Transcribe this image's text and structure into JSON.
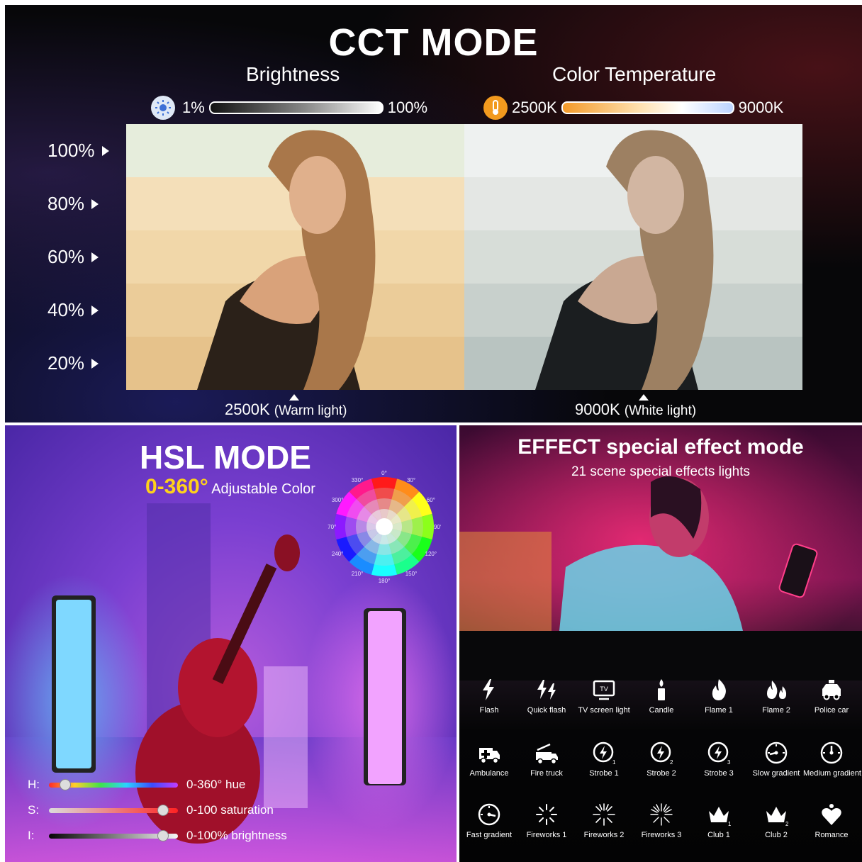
{
  "cct": {
    "title": "CCT MODE",
    "brightness_label": "Brightness",
    "brightness_min": "1%",
    "brightness_max": "100%",
    "color_temp_label": "Color Temperature",
    "temp_min": "2500K",
    "temp_max": "9000K",
    "levels": [
      "100%",
      "80%",
      "60%",
      "40%",
      "20%"
    ],
    "warm_caption": "2500K",
    "warm_caption_note": "(Warm light)",
    "white_caption": "9000K",
    "white_caption_note": "(White light)"
  },
  "hsl": {
    "title": "HSL MODE",
    "range": "0-360°",
    "range_note": "Adjustable Color",
    "wheel_degrees": [
      "0°",
      "30°",
      "60°",
      "90°",
      "120°",
      "150°",
      "180°",
      "210°",
      "240°",
      "270°",
      "300°",
      "330°"
    ],
    "sliders": [
      {
        "key": "H:",
        "label": "0-360° hue",
        "level": 0.12
      },
      {
        "key": "S:",
        "label": "0-100 saturation",
        "level": 0.88
      },
      {
        "key": "I:",
        "label": "0-100% brightness",
        "level": 0.88
      }
    ]
  },
  "effect": {
    "title": "EFFECT special effect mode",
    "subtitle": "21 scene special effects lights",
    "items": [
      {
        "label": "Flash",
        "icon": "lightning-icon"
      },
      {
        "label": "Quick flash",
        "icon": "double-lightning-icon"
      },
      {
        "label": "TV screen light",
        "icon": "tv-icon"
      },
      {
        "label": "Candle",
        "icon": "candle-icon"
      },
      {
        "label": "Flame 1",
        "icon": "flame-icon"
      },
      {
        "label": "Flame 2",
        "icon": "double-flame-icon"
      },
      {
        "label": "Police car",
        "icon": "police-car-icon"
      },
      {
        "label": "Ambulance",
        "icon": "ambulance-icon"
      },
      {
        "label": "Fire truck",
        "icon": "fire-truck-icon"
      },
      {
        "label": "Strobe 1",
        "icon": "strobe-1-icon"
      },
      {
        "label": "Strobe 2",
        "icon": "strobe-2-icon"
      },
      {
        "label": "Strobe 3",
        "icon": "strobe-3-icon"
      },
      {
        "label": "Slow gradient",
        "icon": "gauge-slow-icon"
      },
      {
        "label": "Medium gradient",
        "icon": "gauge-medium-icon"
      },
      {
        "label": "Fast gradient",
        "icon": "gauge-fast-icon"
      },
      {
        "label": "Fireworks 1",
        "icon": "fireworks-1-icon"
      },
      {
        "label": "Fireworks 2",
        "icon": "fireworks-2-icon"
      },
      {
        "label": "Fireworks 3",
        "icon": "fireworks-3-icon"
      },
      {
        "label": "Club 1",
        "icon": "crown-1-icon"
      },
      {
        "label": "Club 2",
        "icon": "crown-2-icon"
      },
      {
        "label": "Romance",
        "icon": "heart-icon"
      }
    ]
  }
}
